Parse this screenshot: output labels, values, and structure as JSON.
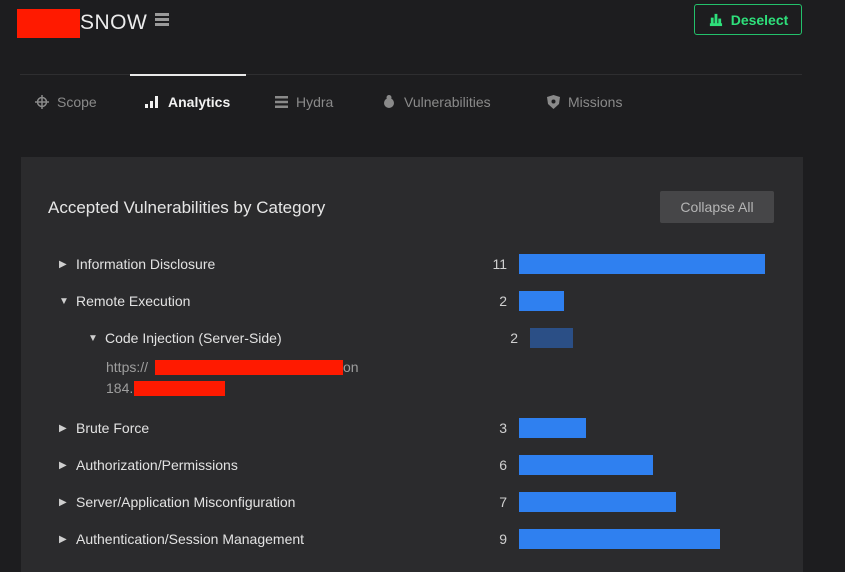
{
  "header": {
    "org_name": "SNOW",
    "org_menu_icon": "list-icon",
    "deselect_label": "Deselect",
    "deselect_icon": "hand-icon",
    "accent_color": "#2ee07b"
  },
  "tabs": [
    {
      "label": "Scope",
      "icon": "crosshair-icon",
      "active": false
    },
    {
      "label": "Analytics",
      "icon": "bar-chart-icon",
      "active": true
    },
    {
      "label": "Hydra",
      "icon": "list-icon",
      "active": false
    },
    {
      "label": "Vulnerabilities",
      "icon": "bug-icon",
      "active": false
    },
    {
      "label": "Missions",
      "icon": "shield-icon",
      "active": false
    }
  ],
  "panel": {
    "title": "Accepted Vulnerabilities by Category",
    "collapse_label": "Collapse All",
    "bar_color": "#2f80f0",
    "sub_bar_color": "#2b4f86"
  },
  "categories": [
    {
      "name": "Information Disclosure",
      "count": "11",
      "value": 11,
      "expanded": false
    },
    {
      "name": "Remote Execution",
      "count": "2",
      "value": 2,
      "expanded": true,
      "children": [
        {
          "name": "Code Injection (Server-Side)",
          "count": "2",
          "value": 2,
          "expanded": true,
          "targets": [
            "https://",
            "on",
            "184."
          ]
        }
      ]
    },
    {
      "name": "Brute Force",
      "count": "3",
      "value": 3,
      "expanded": false
    },
    {
      "name": "Authorization/Permissions",
      "count": "6",
      "value": 6,
      "expanded": false
    },
    {
      "name": "Server/Application Misconfiguration",
      "count": "7",
      "value": 7,
      "expanded": false
    },
    {
      "name": "Authentication/Session Management",
      "count": "9",
      "value": 9,
      "expanded": false
    }
  ]
}
